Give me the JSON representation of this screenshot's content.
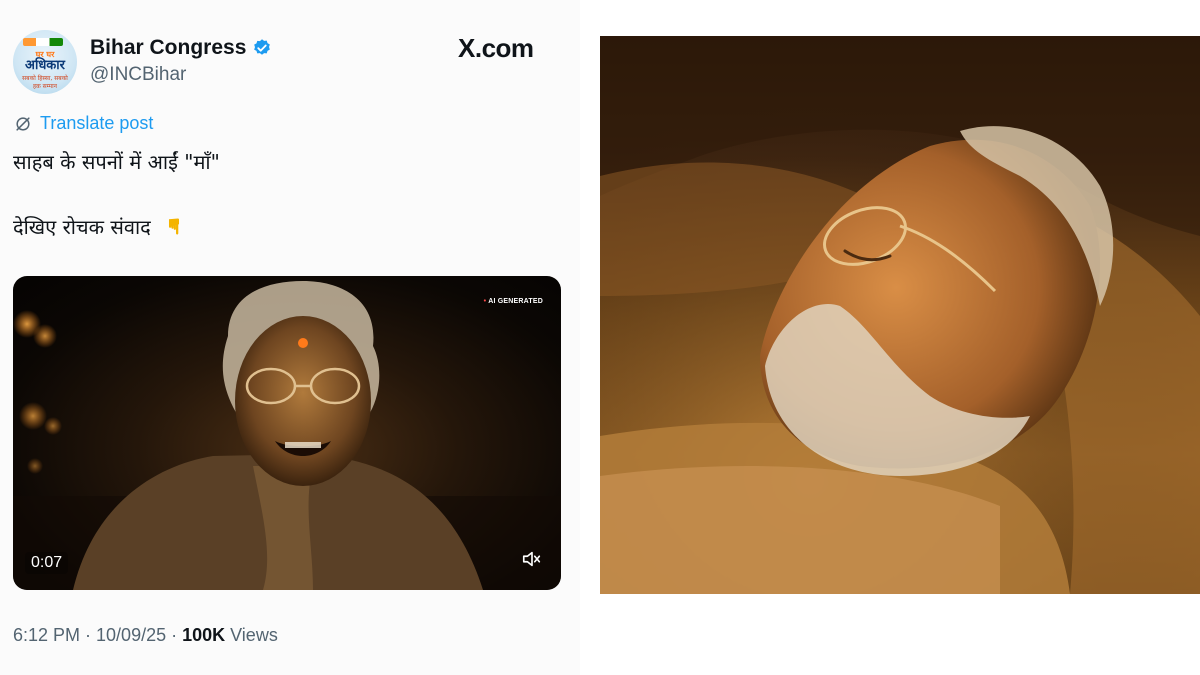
{
  "tweet": {
    "avatar": {
      "line1": "घर घर",
      "line2": "अधिकार",
      "line3": "सबको हिस्सा, सबको",
      "line4": "हक़ सम्मान"
    },
    "account_name": "Bihar Congress",
    "handle": "@INCBihar",
    "site_label": "X.com",
    "translate_label": "Translate post",
    "text_line1": "साहब के सपनों में आईं \"माँ\"",
    "text_line2": "देखिए रोचक संवाद",
    "video": {
      "ai_label": "AI GENERATED",
      "time": "0:07"
    },
    "timestamp": "6:12 PM · 10/09/25 · ",
    "views_count": "100K",
    "views_label": " Views"
  },
  "colors": {
    "link": "#1d9bf0",
    "verified": "#1d9bf0",
    "muted": "#536471"
  },
  "icons": [
    "verified-badge-icon",
    "translate-icon",
    "pointing-down-icon",
    "mute-icon"
  ]
}
